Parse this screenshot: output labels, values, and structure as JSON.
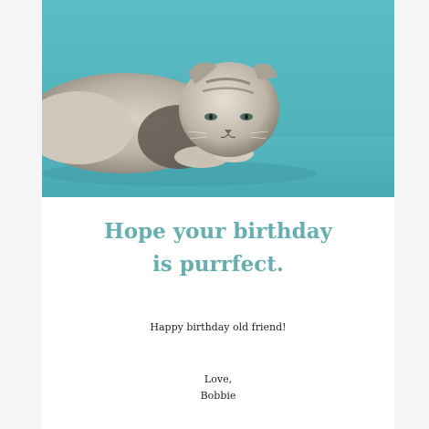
{
  "card": {
    "image_alt": "cat-photo",
    "headline_line1": "Hope your birthday",
    "headline_line2": "is purrfect.",
    "message": "Happy birthday old friend!",
    "closing": "Love,",
    "signature": "Bobbie"
  },
  "colors": {
    "page_background": "#f5f5f5",
    "card_background": "#ffffff",
    "photo_background": "#52b4bd",
    "headline": "#66aeb0",
    "body_text": "#222222"
  }
}
